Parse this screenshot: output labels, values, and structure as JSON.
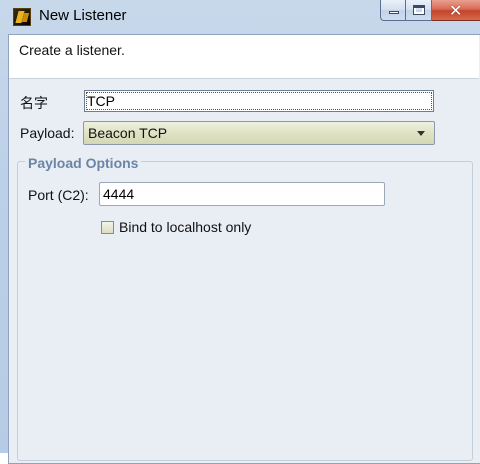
{
  "window": {
    "title": "New Listener"
  },
  "header": {
    "description": "Create a listener."
  },
  "form": {
    "name_label": "名字",
    "name_value": "TCP",
    "payload_label": "Payload:",
    "payload_value": "Beacon TCP"
  },
  "payload_options": {
    "title": "Payload Options",
    "port_label": "Port (C2):",
    "port_value": "4444",
    "bind_localhost_label": "Bind to localhost only",
    "bind_localhost_checked": false
  },
  "icons": {
    "app": "app-logo-icon",
    "minimize": "minimize-icon",
    "maximize": "maximize-icon",
    "close": "close-icon",
    "dropdown": "chevron-down-icon"
  }
}
